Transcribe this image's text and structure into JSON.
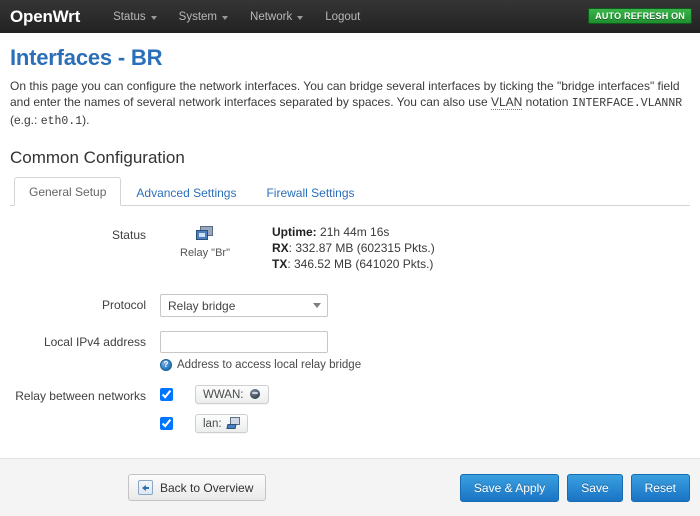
{
  "topbar": {
    "brand": "OpenWrt",
    "menu": [
      {
        "label": "Status",
        "has_caret": true
      },
      {
        "label": "System",
        "has_caret": true
      },
      {
        "label": "Network",
        "has_caret": true
      },
      {
        "label": "Logout",
        "has_caret": false
      }
    ],
    "refresh_badge": "AUTO REFRESH ON",
    "refresh_badge_color": "#39b54a"
  },
  "page": {
    "title": "Interfaces - BR",
    "title_color": "#2b6fba",
    "desc_part1": "On this page you can configure the network interfaces. You can bridge several interfaces by ticking the \"bridge interfaces\" field and enter the names of several network interfaces separated by spaces. You can also use ",
    "desc_vlan": "VLAN",
    "desc_part2": " notation ",
    "desc_mono1": "INTERFACE.VLANNR",
    "desc_part3": " (e.g.: ",
    "desc_mono2": "eth0.1",
    "desc_part4": ")."
  },
  "common_config": {
    "heading": "Common Configuration",
    "tabs": [
      {
        "label": "General Setup",
        "active": true
      },
      {
        "label": "Advanced Settings",
        "active": false
      },
      {
        "label": "Firewall Settings",
        "active": false
      }
    ]
  },
  "form": {
    "status": {
      "label": "Status",
      "iface_icon": "relay-bridge-icon",
      "iface_name": "Relay \"Br\"",
      "uptime_label": "Uptime:",
      "uptime_value": "21h 44m 16s",
      "rx_label": "RX",
      "rx_value": ": 332.87 MB (602315 Pkts.)",
      "tx_label": "TX",
      "tx_value": ": 346.52 MB (641020 Pkts.)"
    },
    "protocol": {
      "label": "Protocol",
      "value": "Relay bridge"
    },
    "local_ipv4": {
      "label": "Local IPv4 address",
      "value": "",
      "placeholder": "",
      "hint": "Address to access local relay bridge",
      "hint_icon": "info-icon"
    },
    "relay_networks": {
      "label": "Relay between networks",
      "items": [
        {
          "name": "WWAN:",
          "checked": true,
          "icon": "wifi-zone-icon"
        },
        {
          "name": "lan:",
          "checked": true,
          "icon": "ethernet-zone-icon"
        }
      ]
    }
  },
  "footer": {
    "back_label": "Back to Overview",
    "back_icon": "back-arrow-icon",
    "save_apply_label": "Save & Apply",
    "save_label": "Save",
    "reset_label": "Reset",
    "button_color": "#1a74c4"
  }
}
